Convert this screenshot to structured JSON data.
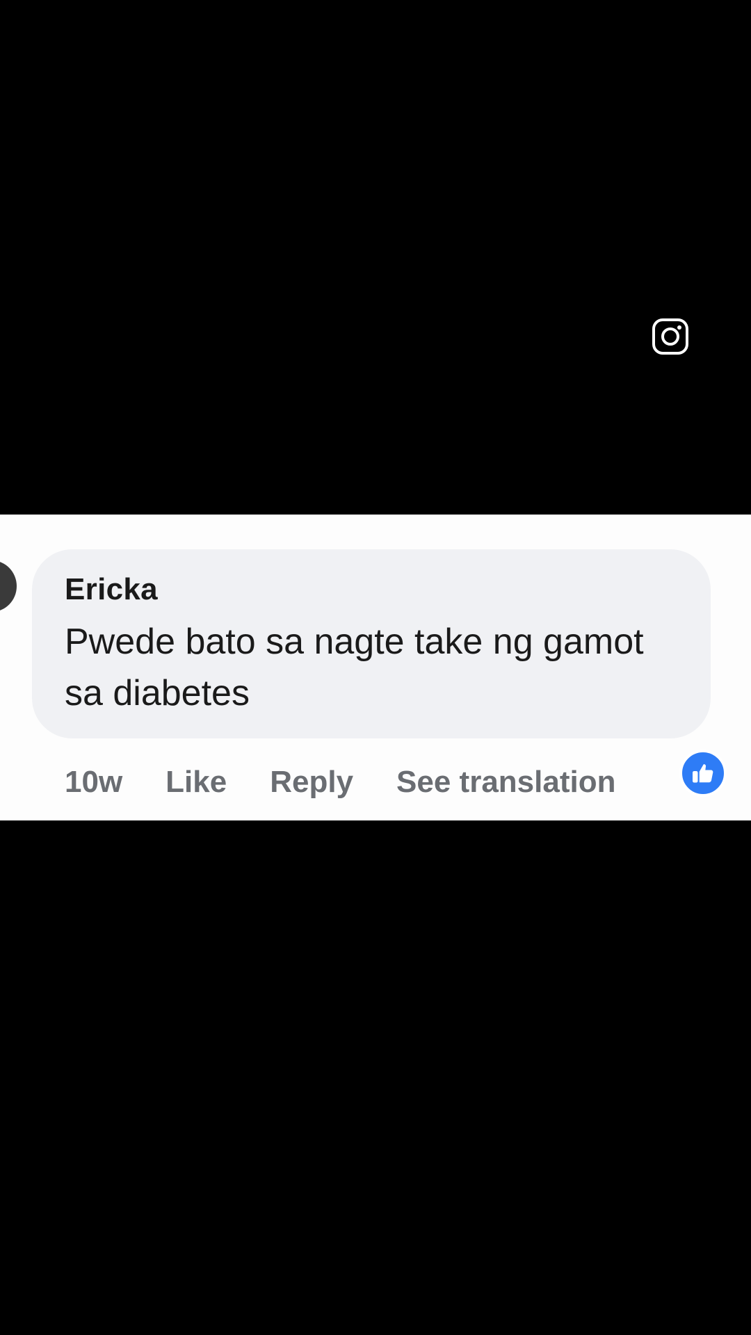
{
  "overlay": {
    "icon": "instagram-icon"
  },
  "comment": {
    "author": "Ericka",
    "text": "Pwede bato sa nagte take ng gamot sa diabetes",
    "time": "10w",
    "actions": {
      "like": "Like",
      "reply": "Reply",
      "translate": "See translation"
    },
    "reaction_icon": "thumbs-up-icon"
  },
  "colors": {
    "background": "#000000",
    "bubble": "#f0f1f4",
    "reaction": "#2e7cf6",
    "action_text": "#6a6d72"
  }
}
